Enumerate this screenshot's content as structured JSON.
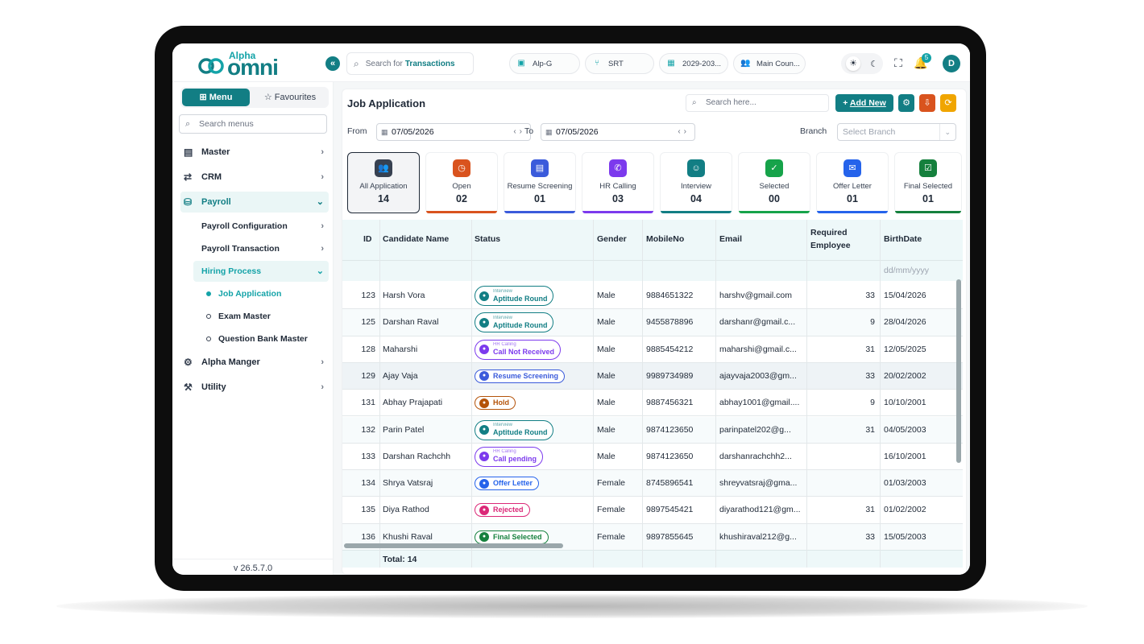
{
  "app": {
    "logo_small": "Alpha",
    "logo_big": "omni",
    "search_prefix": "Search for",
    "search_highlight": "Transactions",
    "pills": [
      {
        "label": "Alp-G"
      },
      {
        "label": "SRT"
      },
      {
        "label": "2029-203..."
      },
      {
        "label": "Main Coun..."
      }
    ],
    "notification_count": "5",
    "avatar_initial": "D"
  },
  "sidebar": {
    "tab_menu": "Menu",
    "tab_favourites": "Favourites",
    "search_placeholder": "Search menus",
    "items": [
      {
        "label": "Master"
      },
      {
        "label": "CRM"
      },
      {
        "label": "Payroll"
      },
      {
        "label": "Payroll Configuration"
      },
      {
        "label": "Payroll Transaction"
      },
      {
        "label": "Hiring Process"
      },
      {
        "label": "Job Application"
      },
      {
        "label": "Exam Master"
      },
      {
        "label": "Question Bank Master"
      },
      {
        "label": "Alpha Manger"
      },
      {
        "label": "Utility"
      }
    ],
    "version": "v 26.5.7.0"
  },
  "main": {
    "title": "Job Application",
    "search_placeholder": "Search here...",
    "add_new": "Add New",
    "from_label": "From",
    "to_label": "To",
    "from_date": "07/05/2026",
    "to_date": "07/05/2026",
    "branch_label": "Branch",
    "branch_placeholder": "Select Branch",
    "stats": [
      {
        "label": "All Application",
        "count": "14",
        "color": "#374151"
      },
      {
        "label": "Open",
        "count": "02",
        "color": "#d9531e"
      },
      {
        "label": "Resume Screening",
        "count": "01",
        "color": "#3b5bdb"
      },
      {
        "label": "HR Calling",
        "count": "03",
        "color": "#7c3aed"
      },
      {
        "label": "Interview",
        "count": "04",
        "color": "#127e84"
      },
      {
        "label": "Selected",
        "count": "00",
        "color": "#16a34a"
      },
      {
        "label": "Offer Letter",
        "count": "01",
        "color": "#2563eb"
      },
      {
        "label": "Final Selected",
        "count": "01",
        "color": "#15803d"
      }
    ],
    "table": {
      "headers": [
        "ID",
        "Candidate Name",
        "Status",
        "Gender",
        "MobileNo",
        "Email",
        "Required",
        "Employee",
        "BirthDate"
      ],
      "birthdate_filter_placeholder": "dd/mm/yyyy",
      "rows": [
        {
          "id": "123",
          "name": "Harsh Vora",
          "status_small": "Interview",
          "status": "Aptitude Round",
          "status_color": "#127e84",
          "gender": "Male",
          "mobile": "9884651322",
          "email": "harshv@gmail.com",
          "req": "33",
          "birth": "15/04/2026"
        },
        {
          "id": "125",
          "name": "Darshan Raval",
          "status_small": "Interview",
          "status": "Aptitude Round",
          "status_color": "#127e84",
          "gender": "Male",
          "mobile": "9455878896",
          "email": "darshanr@gmail.c...",
          "req": "9",
          "birth": "28/04/2026"
        },
        {
          "id": "128",
          "name": "Maharshi",
          "status_small": "HR Calling",
          "status": "Call Not Received",
          "status_color": "#7c3aed",
          "gender": "Male",
          "mobile": "9885454212",
          "email": "maharshi@gmail.c...",
          "req": "31",
          "birth": "12/05/2025"
        },
        {
          "id": "129",
          "name": "Ajay Vaja",
          "status_small": "",
          "status": "Resume Screening",
          "status_color": "#3b5bdb",
          "gender": "Male",
          "mobile": "9989734989",
          "email": "ajayvaja2003@gm...",
          "req": "33",
          "birth": "20/02/2002"
        },
        {
          "id": "131",
          "name": "Abhay Prajapati",
          "status_small": "",
          "status": "Hold",
          "status_color": "#b45309",
          "gender": "Male",
          "mobile": "9887456321",
          "email": "abhay1001@gmail....",
          "req": "9",
          "birth": "10/10/2001"
        },
        {
          "id": "132",
          "name": "Parin Patel",
          "status_small": "Interview",
          "status": "Aptitude Round",
          "status_color": "#127e84",
          "gender": "Male",
          "mobile": "9874123650",
          "email": "parinpatel202@g...",
          "req": "31",
          "birth": "04/05/2003"
        },
        {
          "id": "133",
          "name": "Darshan Rachchh",
          "status_small": "HR Calling",
          "status": "Call pending",
          "status_color": "#7c3aed",
          "gender": "Male",
          "mobile": "9874123650",
          "email": "darshanrachchh2...",
          "req": "",
          "birth": "16/10/2001"
        },
        {
          "id": "134",
          "name": "Shrya Vatsraj",
          "status_small": "",
          "status": "Offer Letter",
          "status_color": "#2563eb",
          "gender": "Female",
          "mobile": "8745896541",
          "email": "shreyvatsraj@gma...",
          "req": "",
          "birth": "01/03/2003"
        },
        {
          "id": "135",
          "name": "Diya Rathod",
          "status_small": "",
          "status": "Rejected",
          "status_color": "#db2777",
          "gender": "Female",
          "mobile": "9897545421",
          "email": "diyarathod121@gm...",
          "req": "31",
          "birth": "01/02/2002"
        },
        {
          "id": "136",
          "name": "Khushi Raval",
          "status_small": "",
          "status": "Final Selected",
          "status_color": "#15803d",
          "gender": "Female",
          "mobile": "9897855645",
          "email": "khushiraval212@g...",
          "req": "33",
          "birth": "15/05/2003"
        }
      ],
      "total": "Total: 14"
    }
  }
}
